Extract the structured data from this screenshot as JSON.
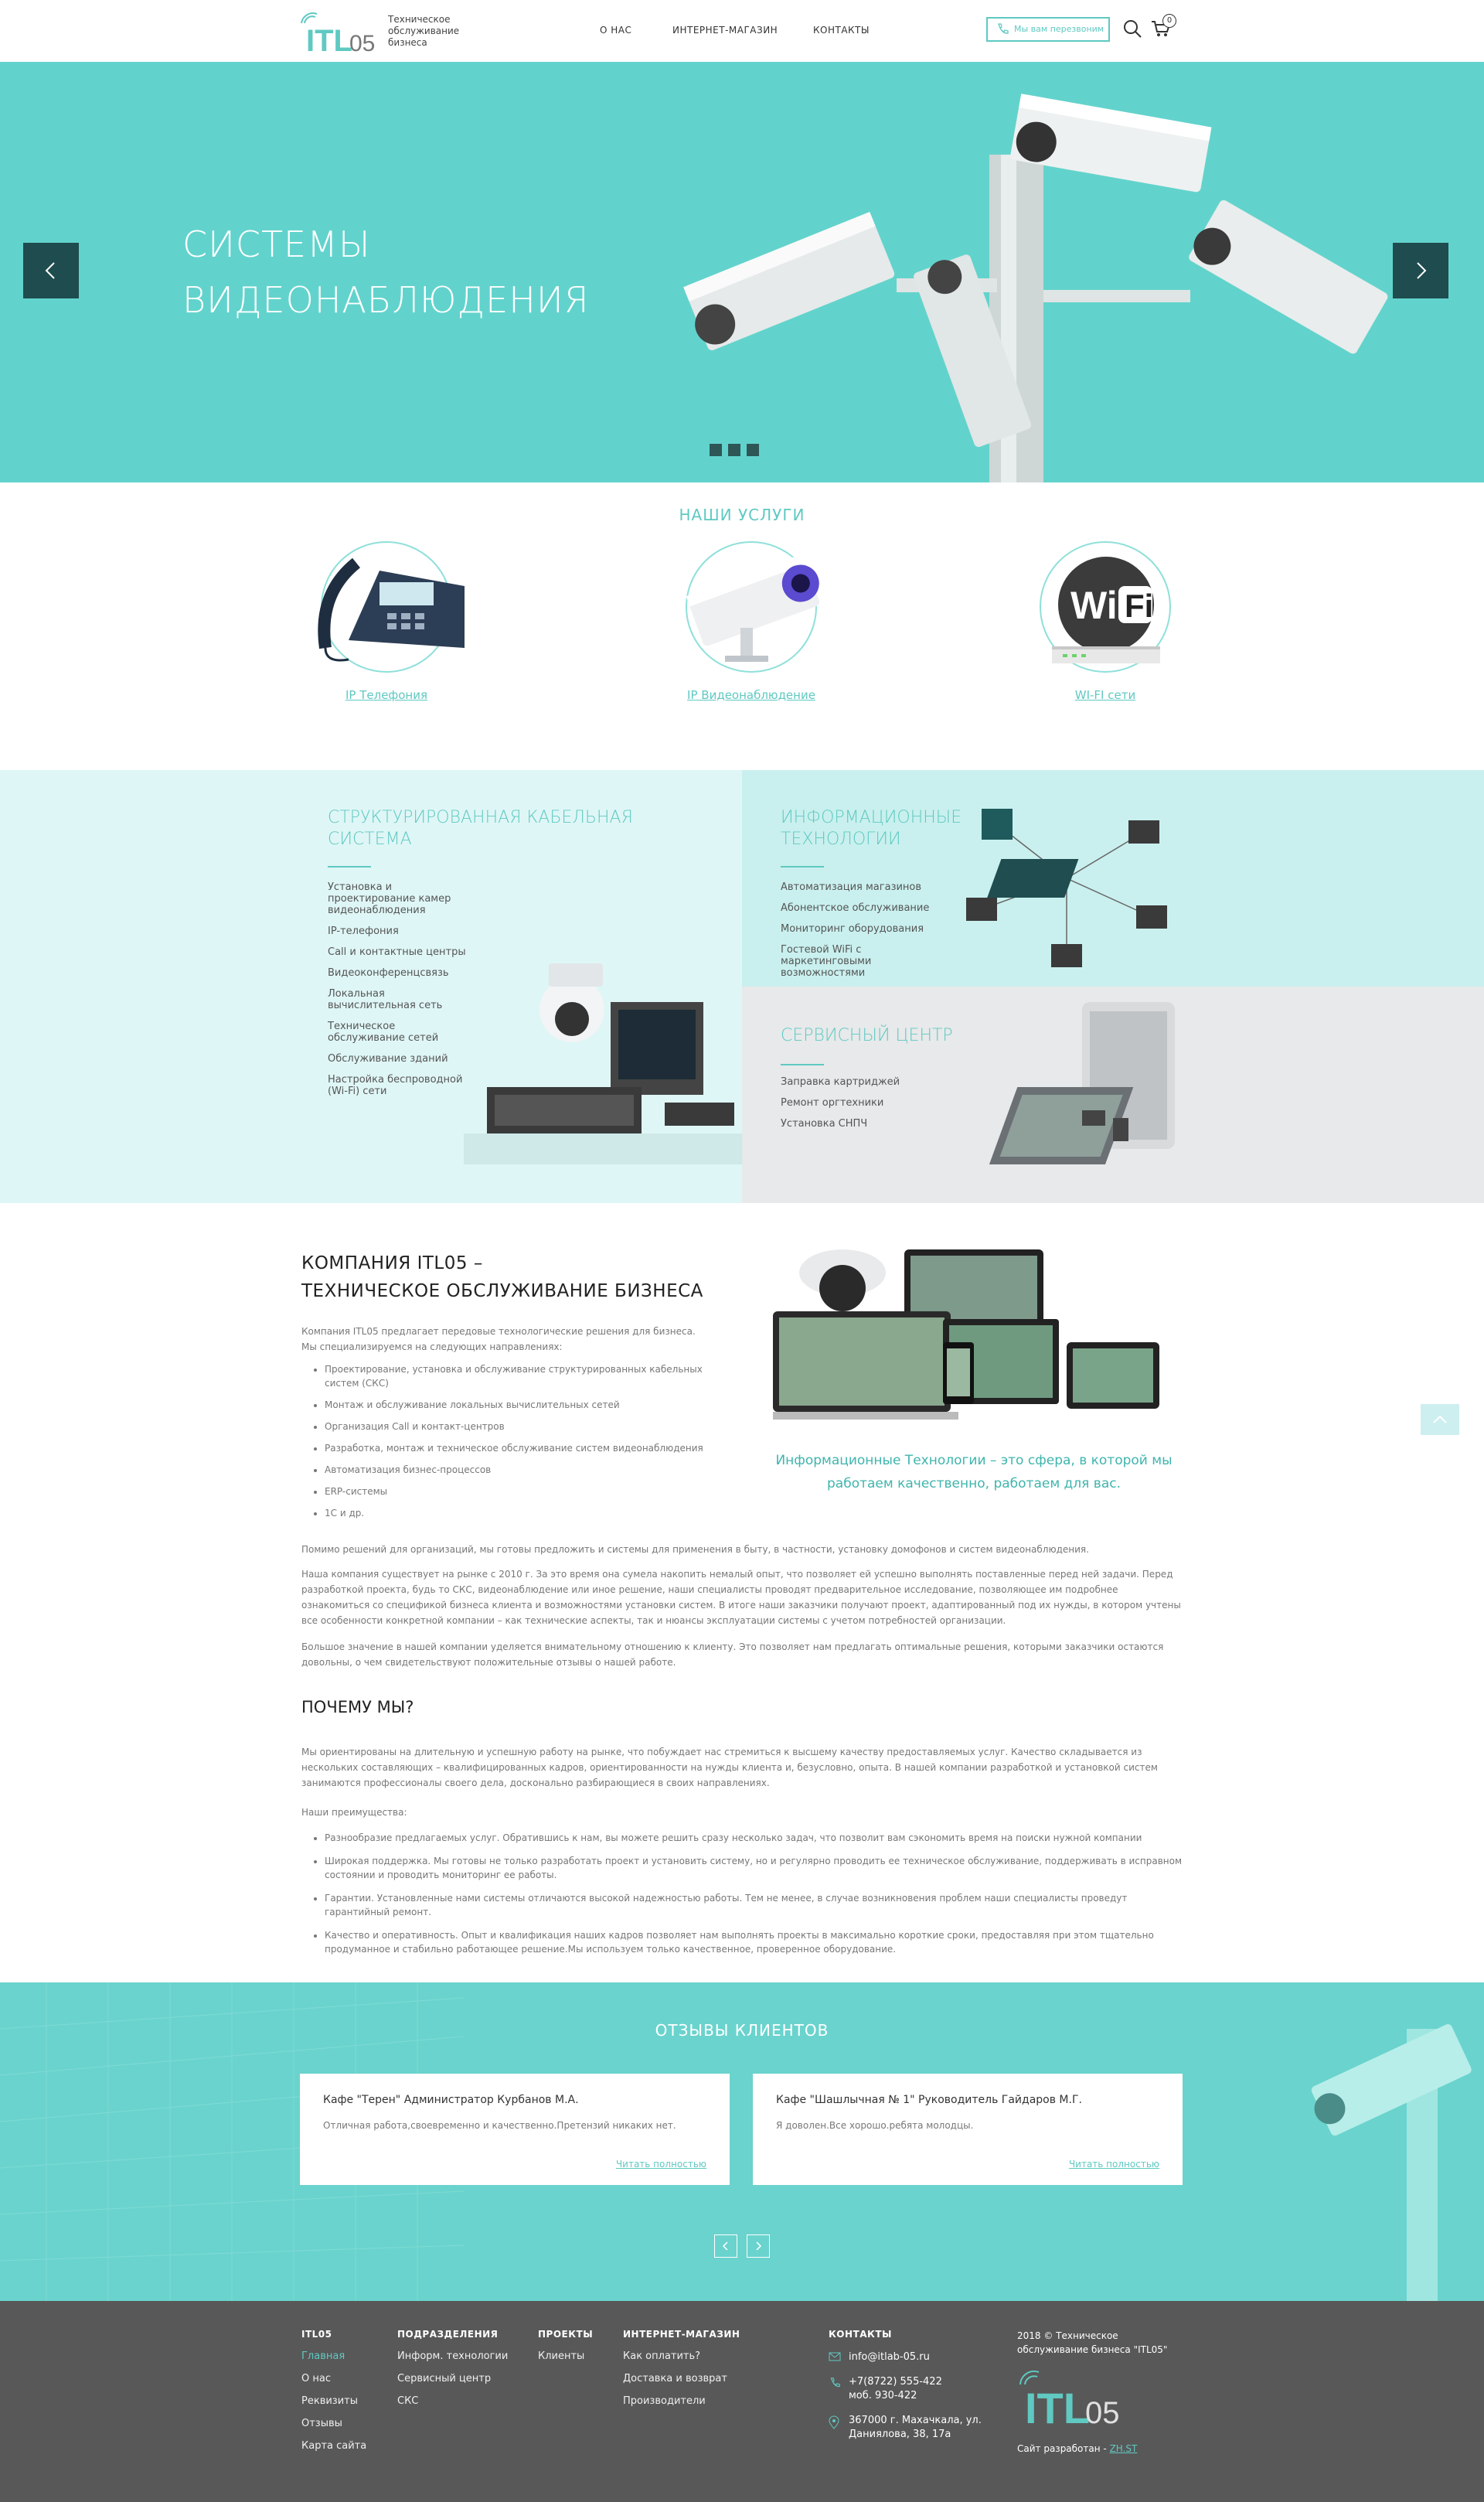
{
  "header": {
    "logo_text": "ITL05",
    "tagline": "Техническое обслуживание бизнеса",
    "nav": [
      "О НАС",
      "ИНТЕРНЕТ-МАГАЗИН",
      "КОНТАКТЫ"
    ],
    "callback_label": "Мы вам перезвоним",
    "cart_count": "0",
    "accent_color": "#5fc9c2"
  },
  "hero": {
    "title_line1": "СИСТЕМЫ",
    "title_line2": "ВИДЕОНАБЛЮДЕНИЯ",
    "background_color": "#62d3cc",
    "slides": 3
  },
  "services": {
    "title": "НАШИ УСЛУГИ",
    "items": [
      {
        "label": "IP Телефония",
        "icon": "phone-icon"
      },
      {
        "label": "IP Видеонаблюдение",
        "icon": "camera-icon"
      },
      {
        "label": "WI-FI сети",
        "icon": "wifi-icon"
      }
    ]
  },
  "blocks": {
    "cable": {
      "title_line1": "СТРУКТУРИРОВАННАЯ КАБЕЛЬНАЯ",
      "title_line2": "СИСТЕМА",
      "items": [
        "Установка и проектирование камер видеонаблюдения",
        "IP-телефония",
        "Call и контактные центры",
        "Видеоконференцсвязь",
        "Локальная вычислительная сеть",
        "Техническое обслуживание сетей",
        "Обслуживание зданий",
        "Настройка беспроводной (Wi-Fi) сети"
      ]
    },
    "it": {
      "title_line1": "ИНФОРМАЦИОННЫЕ",
      "title_line2": "ТЕХНОЛОГИИ",
      "items": [
        "Автоматизация магазинов",
        "Абонентское обслуживание",
        "Мониторинг оборудования",
        "Гостевой WiFi с маркетинговыми возможностями"
      ]
    },
    "service_center": {
      "title": "СЕРВИСНЫЙ ЦЕНТР",
      "items": [
        "Заправка картриджей",
        "Ремонт оргтехники",
        "Установка СНПЧ"
      ]
    }
  },
  "about": {
    "title_line1": "КОМПАНИЯ ITL05 –",
    "title_line2": "ТЕХНИЧЕСКОЕ ОБСЛУЖИВАНИЕ БИЗНЕСА",
    "intro": "Компания ITL05 предлагает передовые технологические решения для бизнеса. Мы специализируемся на следующих направлениях:",
    "list": [
      "Проектирование, установка и обслуживание структурированных кабельных систем (СКС)",
      "Монтаж и обслуживание локальных вычислительных сетей",
      "Организация Call и контакт-центров",
      "Разработка, монтаж и техническое обслуживание систем видеонаблюдения",
      "Автоматизация бизнес-процессов",
      "ERP-системы",
      "1С и др."
    ],
    "quote": "Информационные Технологии – это сфера, в которой мы работаем качественно, работаем для вас.",
    "p1": "Помимо решений для организаций, мы готовы предложить и системы для применения в быту, в частности, установку домофонов и систем видеонаблюдения.",
    "p2": "Наша компания существует на рынке с 2010 г. За это время она сумела накопить немалый опыт, что позволяет ей успешно выполнять поставленные перед ней задачи. Перед разработкой проекта, будь то СКС, видеонаблюдение или иное решение, наши специалисты проводят предварительное исследование, позволяющее им подробнее ознакомиться со спецификой бизнеса клиента и возможностями установки систем. В итоге наши заказчики получают проект, адаптированный под их нужды, в котором учтены все особенности конкретной компании – как технические аспекты, так и нюансы эксплуатации системы с учетом потребностей организации.",
    "p3": "Большое значение в нашей компании уделяется внимательному отношению к клиенту. Это позволяет нам предлагать оптимальные решения, которыми заказчики остаются довольны, о чем свидетельствуют положительные отзывы о нашей работе."
  },
  "why": {
    "title": "ПОЧЕМУ МЫ?",
    "p1": "Мы ориентированы на длительную и успешную работу на рынке, что побуждает нас стремиться к высшему качеству предоставляемых услуг. Качество складывается из нескольких составляющих – квалифицированных кадров, ориентированности на нужды клиента и, безусловно, опыта. В нашей компании разработкой и установкой систем занимаются профессионалы своего дела, досконально разбирающиеся в своих направлениях.",
    "advantages_label": "Наши преимущества:",
    "list": [
      "Разнообразие предлагаемых услуг. Обратившись к нам, вы можете решить сразу несколько задач, что позволит вам сэкономить время на поиски нужной компании",
      "Широкая поддержка. Мы готовы не только разработать проект и установить систему, но и регулярно проводить ее техническое обслуживание, поддерживать в исправном состоянии и проводить мониторинг ее работы.",
      "Гарантии. Установленные нами системы отличаются высокой надежностью работы. Тем не менее, в случае возникновения проблем наши специалисты проведут гарантийный ремонт.",
      "Качество и оперативность. Опыт и квалификация наших кадров позволяет нам выполнять проекты в максимально короткие сроки, предоставляя при этом тщательно продуманное и стабильно работающее решение.Мы используем только качественное, проверенное оборудование."
    ]
  },
  "reviews": {
    "title": "ОТЗЫВЫ КЛИЕНТОВ",
    "items": [
      {
        "name": "Кафе \"Терен\" Администратор Курбанов М.А.",
        "text": "Отличная работа,своевременно и качественно.Претензий никаких нет.",
        "more": "Читать полностью"
      },
      {
        "name": "Кафе \"Шашлычная № 1\" Руководитель Гайдаров М.Г.",
        "text": "Я доволен.Все хорошо.ребята молодцы.",
        "more": "Читать полностью"
      }
    ]
  },
  "footer": {
    "cols": [
      {
        "head": "ITL05",
        "items": [
          "Главная",
          "О нас",
          "Реквизиты",
          "Отзывы",
          "Карта сайта"
        ]
      },
      {
        "head": "ПОДРАЗДЕЛЕНИЯ",
        "items": [
          "Информ. технологии",
          "Сервисный центр",
          "СКС"
        ]
      },
      {
        "head": "ПРОЕКТЫ",
        "items": [
          "Клиенты"
        ]
      },
      {
        "head": "ИНТЕРНЕТ-МАГАЗИН",
        "items": [
          "Как оплатить?",
          "Доставка и возврат",
          "Производители"
        ]
      }
    ],
    "contacts_head": "КОНТАКТЫ",
    "email": "info@itlab-05.ru",
    "phone1": "+7(8722) 555-422",
    "phone2": "моб. 930-422",
    "address": "367000 г. Махачкала, ул. Даниялова, 38, 17а",
    "copyright": "2018 © Техническое обслуживание бизнеса \"ITL05\"",
    "dev_label": "Сайт разработан -",
    "dev_link": "ZH.ST",
    "bg_color": "#585858"
  }
}
